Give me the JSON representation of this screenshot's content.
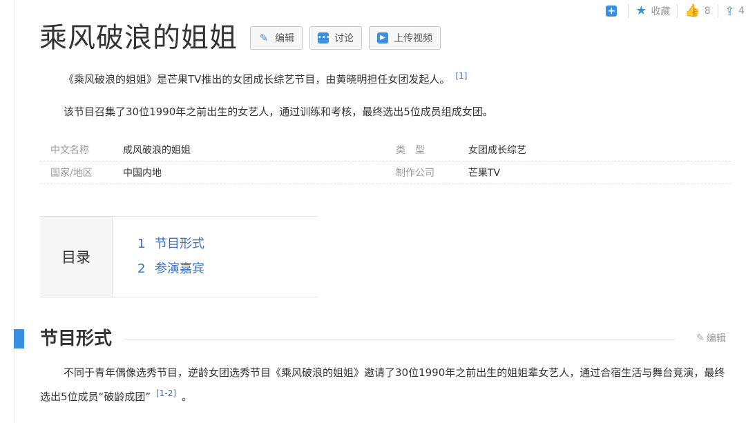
{
  "toolbar": {
    "add_icon": "plus-box-icon",
    "favorite_label": "收藏",
    "like_count": "8",
    "share_count": "4"
  },
  "title": "乘风破浪的姐姐",
  "title_buttons": {
    "edit": "编辑",
    "discuss": "讨论",
    "upload_video": "上传视频"
  },
  "intro": {
    "p1": "《乘风破浪的姐姐》是芒果TV推出的女团成长综艺节目，由黄晓明担任女团发起人。",
    "p1_ref": "[1]",
    "p2": "该节目召集了30位1990年之前出生的女艺人，通过训练和考核，最终选出5位成员组成女团。"
  },
  "info": [
    {
      "label": "中文名称",
      "value": "成风破浪的姐姐",
      "label2": "类　型",
      "value2": "女团成长综艺"
    },
    {
      "label": "国家/地区",
      "value": "中国内地",
      "label2": "制作公司",
      "value2": "芒果TV"
    }
  ],
  "catalog": {
    "heading": "目录",
    "items": [
      {
        "num": "1",
        "label": "节目形式"
      },
      {
        "num": "2",
        "label": "参演嘉宾"
      }
    ]
  },
  "section": {
    "title": "节目形式",
    "edit_label": "编辑",
    "body": "不同于青年偶像选秀节目，逆龄女团选秀节目《乘风破浪的姐姐》邀请了30位1990年之前出生的姐姐辈女艺人，通过合宿生活与舞台竞演，最终选出5位成员“破龄成团”",
    "ref": "[1-2]",
    "tail": "。"
  },
  "colors": {
    "accent": "#3a8fe0",
    "link": "#3a6fc4"
  }
}
